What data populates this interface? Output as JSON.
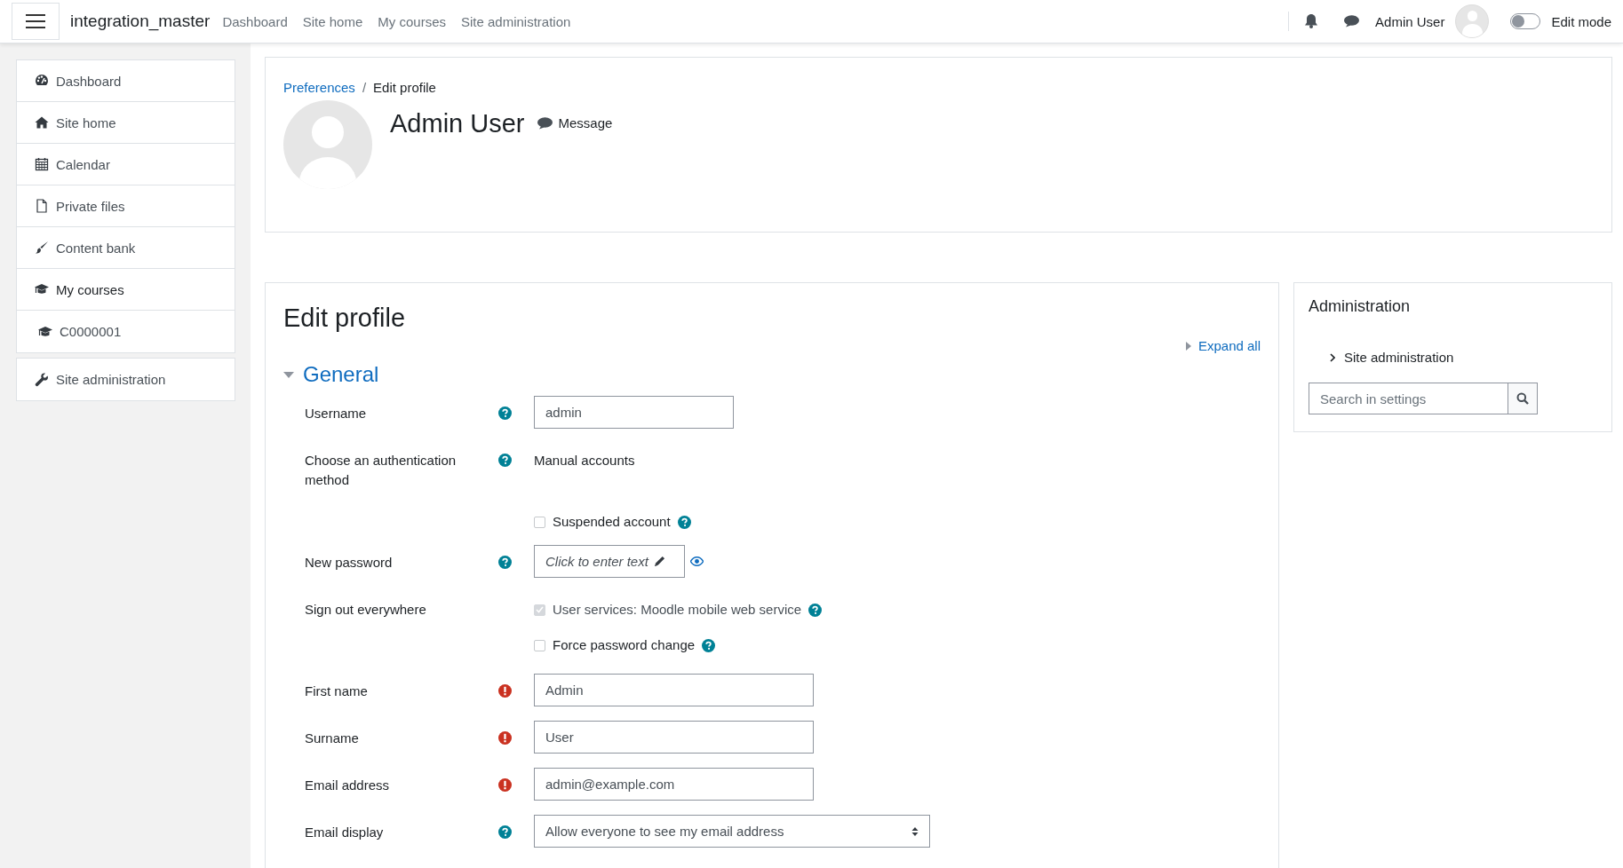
{
  "topbar": {
    "brand": "integration_master",
    "nav": [
      {
        "label": "Dashboard"
      },
      {
        "label": "Site home"
      },
      {
        "label": "My courses"
      },
      {
        "label": "Site administration"
      }
    ],
    "user_name": "Admin User",
    "edit_mode": {
      "label": "Edit mode",
      "on": false
    }
  },
  "sidebar": {
    "groups": [
      {
        "items": [
          {
            "label": "Dashboard",
            "selected": false
          },
          {
            "label": "Site home",
            "selected": false
          },
          {
            "label": "Calendar",
            "selected": false
          },
          {
            "label": "Private files",
            "selected": false
          },
          {
            "label": "Content bank",
            "selected": false
          },
          {
            "label": "My courses",
            "selected": true,
            "children": [
              {
                "label": "C0000001",
                "selected": false
              }
            ]
          }
        ]
      },
      {
        "items": [
          {
            "label": "Site administration",
            "selected": false
          }
        ]
      }
    ]
  },
  "header": {
    "breadcrumbs": [
      {
        "label": "Preferences",
        "link": true
      },
      {
        "label": "Edit profile",
        "link": false
      }
    ],
    "separator": "/",
    "name": "Admin User",
    "message": "Message"
  },
  "form": {
    "title": "Edit profile",
    "expand_all": "Expand all",
    "section": {
      "title": "General",
      "expanded": true
    },
    "fields": [
      {
        "kind": "short_text",
        "label": "Username",
        "help": true,
        "required": false,
        "value": "admin"
      },
      {
        "kind": "static",
        "label": "Choose an authentication method",
        "help": true,
        "required": false,
        "value": "Manual accounts"
      },
      {
        "kind": "checkbox",
        "option": "Suspended account",
        "checked": false,
        "disabled": false,
        "help": true
      },
      {
        "kind": "password",
        "label": "New password",
        "help": true,
        "required": false,
        "value": "Click to enter text"
      },
      {
        "kind": "checkbox",
        "label": "Sign out everywhere",
        "option": "User services: Moodle mobile web service",
        "checked": true,
        "disabled": true,
        "help": true
      },
      {
        "kind": "checkbox",
        "option": "Force password change",
        "checked": false,
        "disabled": false,
        "help": true
      },
      {
        "kind": "text",
        "label": "First name",
        "help": false,
        "required": true,
        "value": "Admin"
      },
      {
        "kind": "text",
        "label": "Surname",
        "help": false,
        "required": true,
        "value": "User"
      },
      {
        "kind": "text",
        "label": "Email address",
        "help": false,
        "required": true,
        "value": "admin@example.com"
      },
      {
        "kind": "select",
        "label": "Email display",
        "help": true,
        "required": false,
        "value": "Allow everyone to see my email address"
      }
    ]
  },
  "admin_block": {
    "title": "Administration",
    "items": [
      {
        "label": "Site administration",
        "expanded": false
      }
    ],
    "search": {
      "placeholder": "Search in settings"
    }
  }
}
